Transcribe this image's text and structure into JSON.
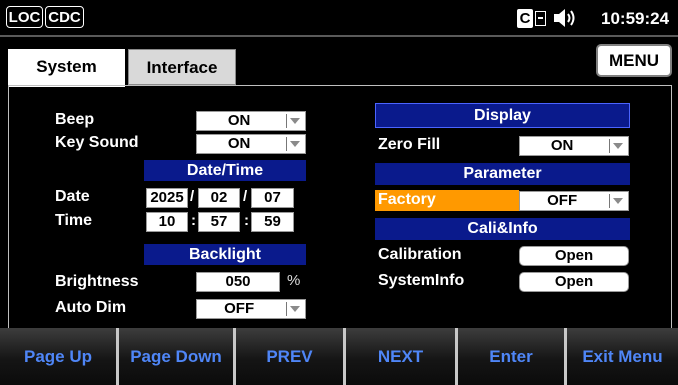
{
  "status": {
    "loc_label": "LOC",
    "cdc_label": "CDC",
    "time": "10:59:24",
    "icons": [
      "cab-icon",
      "speaker-icon"
    ]
  },
  "tabs": [
    {
      "label": "System",
      "active": true
    },
    {
      "label": "Interface",
      "active": false
    }
  ],
  "menu_label": "MENU",
  "left": {
    "beep_label": "Beep",
    "beep_value": "ON",
    "keysound_label": "Key Sound",
    "keysound_value": "ON",
    "datetime_header": "Date/Time",
    "date_label": "Date",
    "date_year": "2025",
    "date_month": "02",
    "date_day": "07",
    "date_sep": "/",
    "time_label": "Time",
    "time_hour": "10",
    "time_min": "57",
    "time_sec": "59",
    "time_sep": ":",
    "backlight_header": "Backlight",
    "brightness_label": "Brightness",
    "brightness_value": "050",
    "brightness_unit": "%",
    "autodim_label": "Auto Dim",
    "autodim_value": "OFF"
  },
  "right": {
    "display_header": "Display",
    "zerofill_label": "Zero Fill",
    "zerofill_value": "ON",
    "parameter_header": "Parameter",
    "factory_label": "Factory",
    "factory_value": "OFF",
    "cali_header": "Cali&Info",
    "calibration_label": "Calibration",
    "calibration_button": "Open",
    "sysinfo_label": "SystemInfo",
    "sysinfo_button": "Open"
  },
  "softkeys": [
    "Page Up",
    "Page Down",
    "PREV",
    "NEXT",
    "Enter",
    "Exit Menu"
  ],
  "colors": {
    "header_bg": "#0a1a8c",
    "highlight": "#ff9900",
    "softkey_text": "#4f86f7"
  }
}
